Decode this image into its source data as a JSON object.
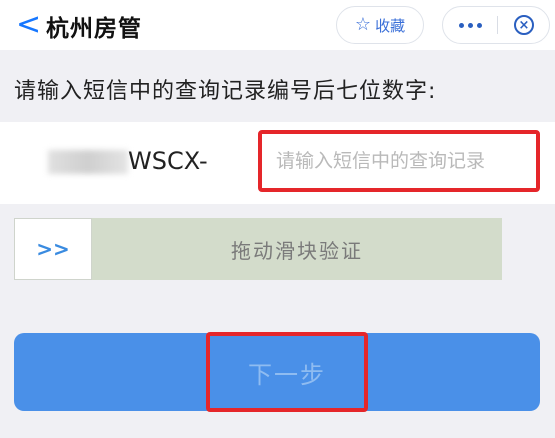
{
  "header": {
    "back_glyph": "<",
    "title": "杭州房管",
    "favorite_label": "收藏"
  },
  "prompt": "请输入短信中的查询记录编号后七位数字:",
  "code": {
    "prefix": "WSCX-",
    "placeholder": "请输入短信中的查询记录"
  },
  "slider": {
    "handle": ">>",
    "label": "拖动滑块验证"
  },
  "next_label": "下一步",
  "colors": {
    "accent": "#4a90e8",
    "highlight": "#e5262a",
    "slider_track": "#d3dccb"
  }
}
